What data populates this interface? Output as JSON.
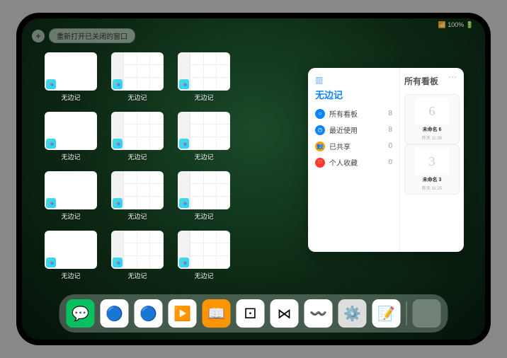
{
  "status": {
    "text": "📶 100% 🔋"
  },
  "topbar": {
    "plus": "+",
    "pill": "重新打开已关闭的窗口"
  },
  "windows": [
    {
      "label": "无边记",
      "type": "blank"
    },
    {
      "label": "无边记",
      "type": "cal"
    },
    {
      "label": "无边记",
      "type": "cal"
    },
    {
      "label": "无边记",
      "type": "blank"
    },
    {
      "label": "无边记",
      "type": "cal"
    },
    {
      "label": "无边记",
      "type": "cal"
    },
    {
      "label": "无边记",
      "type": "blank"
    },
    {
      "label": "无边记",
      "type": "cal"
    },
    {
      "label": "无边记",
      "type": "cal"
    },
    {
      "label": "无边记",
      "type": "blank"
    },
    {
      "label": "无边记",
      "type": "cal"
    },
    {
      "label": "无边记",
      "type": "cal"
    }
  ],
  "panel": {
    "leftTitle": "无边记",
    "items": [
      {
        "icon": "○",
        "color": "#0a84ff",
        "label": "所有看板",
        "count": "8"
      },
      {
        "icon": "◷",
        "color": "#0a84ff",
        "label": "最近使用",
        "count": "8"
      },
      {
        "icon": "👥",
        "color": "#ff9f0a",
        "label": "已共享",
        "count": "0"
      },
      {
        "icon": "♡",
        "color": "#ff3b30",
        "label": "个人收藏",
        "count": "0"
      }
    ],
    "rightTitle": "所有看板",
    "boards": [
      {
        "glyph": "6",
        "title": "未命名 6",
        "date": "昨天 11:26"
      },
      {
        "glyph": "3",
        "title": "未命名 3",
        "date": "昨天 11:25"
      }
    ]
  },
  "dock": [
    {
      "name": "wechat",
      "bg": "#07c160",
      "glyph": "💬"
    },
    {
      "name": "ucloud",
      "bg": "#fff",
      "glyph": "🔵"
    },
    {
      "name": "qq",
      "bg": "#fff",
      "glyph": "🔵"
    },
    {
      "name": "media",
      "bg": "#fff",
      "glyph": "▶️"
    },
    {
      "name": "books",
      "bg": "#ff9500",
      "glyph": "📖"
    },
    {
      "name": "dice",
      "bg": "#fff",
      "glyph": "⚀"
    },
    {
      "name": "connect",
      "bg": "#fff",
      "glyph": "⋈"
    },
    {
      "name": "freeform",
      "bg": "#fff",
      "glyph": "〰️"
    },
    {
      "name": "settings",
      "bg": "#ddd",
      "glyph": "⚙️"
    },
    {
      "name": "notes",
      "bg": "#fff",
      "glyph": "📝"
    }
  ],
  "folderApps": [
    "#4cd964",
    "#ff9500",
    "#007aff",
    "#5ac8fa"
  ]
}
